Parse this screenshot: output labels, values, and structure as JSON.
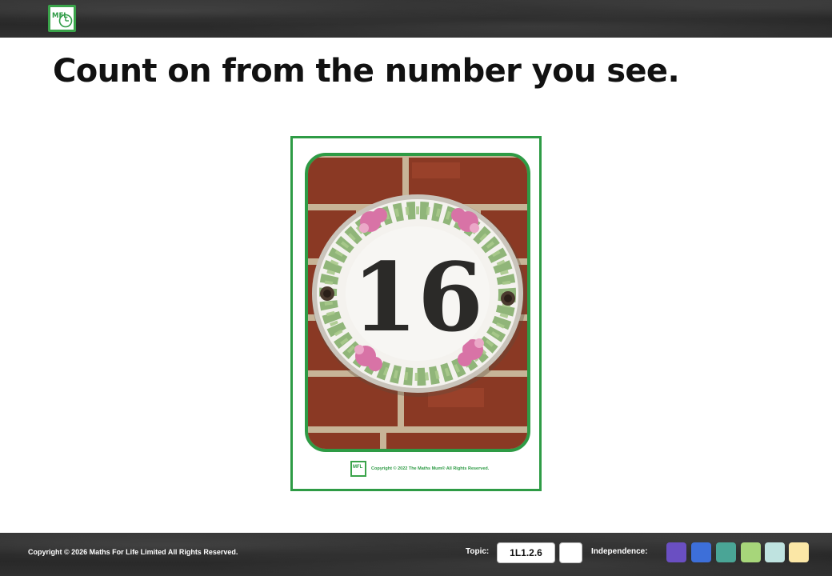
{
  "header": {
    "logo_icon": "mfl-logo-icon",
    "logo_text": "MFL"
  },
  "main": {
    "title": "Count on from the number you see.",
    "card": {
      "number": "16",
      "copyright": "Copyright © 2022 The Maths Mum® All Rights Reserved.",
      "logo_text": "MFL"
    }
  },
  "footer": {
    "copyright": "Copyright © 2026 Maths For Life Limited All Rights Reserved.",
    "topic_label": "Topic:",
    "topic_code": "1L1.2.6",
    "independence_label": "Independence:",
    "independence_colors": [
      "#6a4fc2",
      "#3d6fd9",
      "#4aa596",
      "#a7d67a",
      "#bfe3e0",
      "#fbe7a6"
    ]
  },
  "colors": {
    "accent_green": "#2e9b45",
    "bar_dark": "#2b2b2b"
  }
}
